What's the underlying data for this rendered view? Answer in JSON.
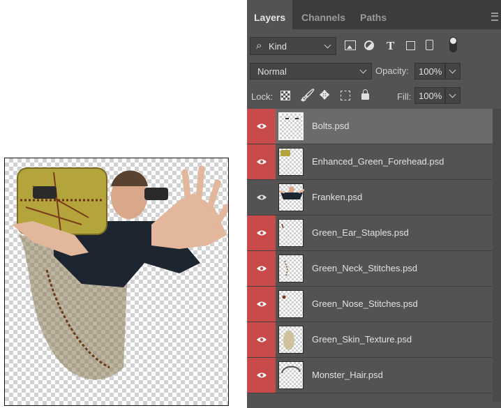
{
  "tabs": [
    {
      "label": "Layers",
      "active": true
    },
    {
      "label": "Channels",
      "active": false
    },
    {
      "label": "Paths",
      "active": false
    }
  ],
  "filter": {
    "value": "Kind",
    "icons": [
      "image-filter-icon",
      "adjustment-filter-icon",
      "type-filter-icon",
      "shape-filter-icon",
      "smart-object-filter-icon",
      "filter-toggle-icon"
    ]
  },
  "blend_mode": {
    "value": "Normal"
  },
  "opacity": {
    "label": "Opacity:",
    "value": "100%"
  },
  "lock": {
    "label": "Lock:",
    "icons": [
      "lock-transparent-pixels-icon",
      "lock-image-pixels-icon",
      "lock-position-icon",
      "lock-artboard-icon",
      "lock-all-icon"
    ]
  },
  "fill": {
    "label": "Fill:",
    "value": "100%"
  },
  "layers": [
    {
      "name": "Bolts.psd",
      "visible": true,
      "selected": true
    },
    {
      "name": "Enhanced_Green_Forehead.psd",
      "visible": true,
      "selected": false
    },
    {
      "name": "Franken.psd",
      "visible": false,
      "selected": false
    },
    {
      "name": "Green_Ear_Staples.psd",
      "visible": true,
      "selected": false
    },
    {
      "name": "Green_Neck_Stitches.psd",
      "visible": true,
      "selected": false
    },
    {
      "name": "Green_Nose_Stitches.psd",
      "visible": true,
      "selected": false
    },
    {
      "name": "Green_Skin_Texture.psd",
      "visible": true,
      "selected": false
    },
    {
      "name": "Monster_Hair.psd",
      "visible": true,
      "selected": false
    }
  ],
  "colors": {
    "visible_cell": "#c84a4a",
    "panel": "#535353",
    "selected_row": "#6b6b6b"
  }
}
